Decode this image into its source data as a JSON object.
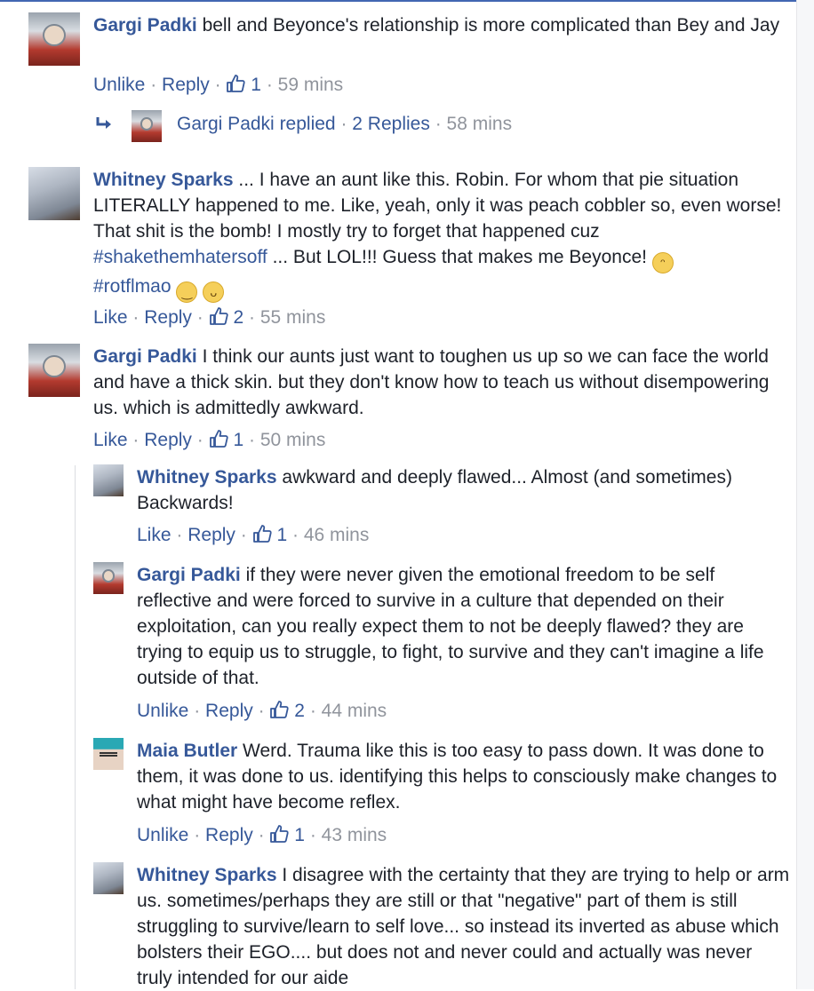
{
  "sep": "·",
  "comments": [
    {
      "author": "Gargi Padki",
      "text": "bell and Beyonce's relationship is more complicated than Bey and Jay",
      "like_label": "Unlike",
      "reply_label": "Reply",
      "likes": "1",
      "time": "59 mins"
    },
    {
      "author": "Whitney Sparks",
      "text_a": "... I have an aunt like this. Robin. For whom that pie situation LITERALLY happened to me. Like, yeah, only it was peach cobbler so, even worse! That shit is the bomb! I mostly try to forget that happened cuz",
      "hashtag1": "#shakethemhatersoff",
      "text_b": "... But LOL!!! Guess that makes me Beyonce!",
      "hashtag2": "#rotflmao",
      "like_label": "Like",
      "reply_label": "Reply",
      "likes": "2",
      "time": "55 mins"
    },
    {
      "author": "Gargi Padki",
      "text": "I think our aunts just want to toughen us up so we can face the world and have a thick skin. but they don't know how to teach us without disempowering us. which is admittedly awkward.",
      "like_label": "Like",
      "reply_label": "Reply",
      "likes": "1",
      "time": "50 mins"
    }
  ],
  "replied_summary": {
    "name": "Gargi Padki",
    "verb": "replied",
    "count_label": "2 Replies",
    "time": "58 mins"
  },
  "replies": [
    {
      "author": "Whitney Sparks",
      "text": "awkward and deeply flawed... Almost (and sometimes) Backwards!",
      "like_label": "Like",
      "reply_label": "Reply",
      "likes": "1",
      "time": "46 mins"
    },
    {
      "author": "Gargi Padki",
      "text": "if they were never given the emotional freedom to be self reflective and were forced to survive in a culture that depended on their exploitation, can you really expect them to not be deeply flawed? they are trying to equip us to struggle, to fight, to survive and they can't imagine a life outside of that.",
      "like_label": "Unlike",
      "reply_label": "Reply",
      "likes": "2",
      "time": "44 mins"
    },
    {
      "author": "Maia Butler",
      "text": "Werd. Trauma like this is too easy to pass down. It was done to them, it was done to us. identifying this helps to consciously make changes to what might have become reflex.",
      "like_label": "Unlike",
      "reply_label": "Reply",
      "likes": "1",
      "time": "43 mins"
    },
    {
      "author": "Whitney Sparks",
      "text": "I disagree with the certainty that they are trying to help or arm us. sometimes/perhaps they are still or that \"negative\" part of them is still struggling to survive/learn to self love... so instead its inverted as abuse which bolsters their EGO.... but does not and never could and actually was never truly intended for our aide",
      "like_label": "",
      "reply_label": "",
      "likes": "",
      "time": ""
    }
  ],
  "colors": {
    "link": "#365899",
    "meta": "#90949c",
    "text": "#1d2129"
  },
  "icons": {
    "like": "thumbs-up-icon",
    "reply_arrow": "reply-arrow-icon",
    "emoji1": "grinning-face-icon",
    "emoji2": "smiling-face-icon",
    "emoji3": "tongue-face-icon"
  }
}
